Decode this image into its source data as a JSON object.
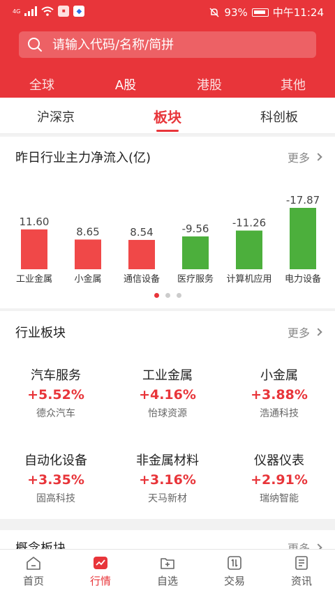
{
  "status": {
    "network": "4G",
    "battery": "93%",
    "time": "中午11:24"
  },
  "search": {
    "placeholder": "请输入代码/名称/简拼"
  },
  "main_tabs": [
    "全球",
    "A股",
    "港股",
    "其他"
  ],
  "sub_tabs": [
    "沪深京",
    "板块",
    "科创板"
  ],
  "flow": {
    "title": "昨日行业主力净流入(亿)",
    "more": "更多"
  },
  "chart_data": {
    "type": "bar",
    "title": "昨日行业主力净流入(亿)",
    "categories": [
      "工业金属",
      "小金属",
      "通信设备",
      "医疗服务",
      "计算机应用",
      "电力设备"
    ],
    "values": [
      11.6,
      8.65,
      8.54,
      -9.56,
      -11.26,
      -17.87
    ],
    "value_labels": [
      "11.60",
      "8.65",
      "8.54",
      "-9.56",
      "-11.26",
      "-17.87"
    ],
    "colors": {
      "positive": "#f04848",
      "negative": "#4caf3c"
    }
  },
  "industry": {
    "title": "行业板块",
    "more": "更多",
    "items": [
      {
        "name": "汽车服务",
        "pct": "+5.52%",
        "stock": "德众汽车"
      },
      {
        "name": "工业金属",
        "pct": "+4.16%",
        "stock": "怡球资源"
      },
      {
        "name": "小金属",
        "pct": "+3.88%",
        "stock": "浩通科技"
      },
      {
        "name": "自动化设备",
        "pct": "+3.35%",
        "stock": "固高科技"
      },
      {
        "name": "非金属材料",
        "pct": "+3.16%",
        "stock": "天马新材"
      },
      {
        "name": "仪器仪表",
        "pct": "+2.91%",
        "stock": "瑞纳智能"
      }
    ]
  },
  "concept": {
    "title": "概念板块",
    "more": "更多"
  },
  "tabbar": [
    "首页",
    "行情",
    "自选",
    "交易",
    "资讯"
  ],
  "colors": {
    "brand": "#e8353a",
    "up": "#e8353a",
    "down": "#4caf3c"
  }
}
